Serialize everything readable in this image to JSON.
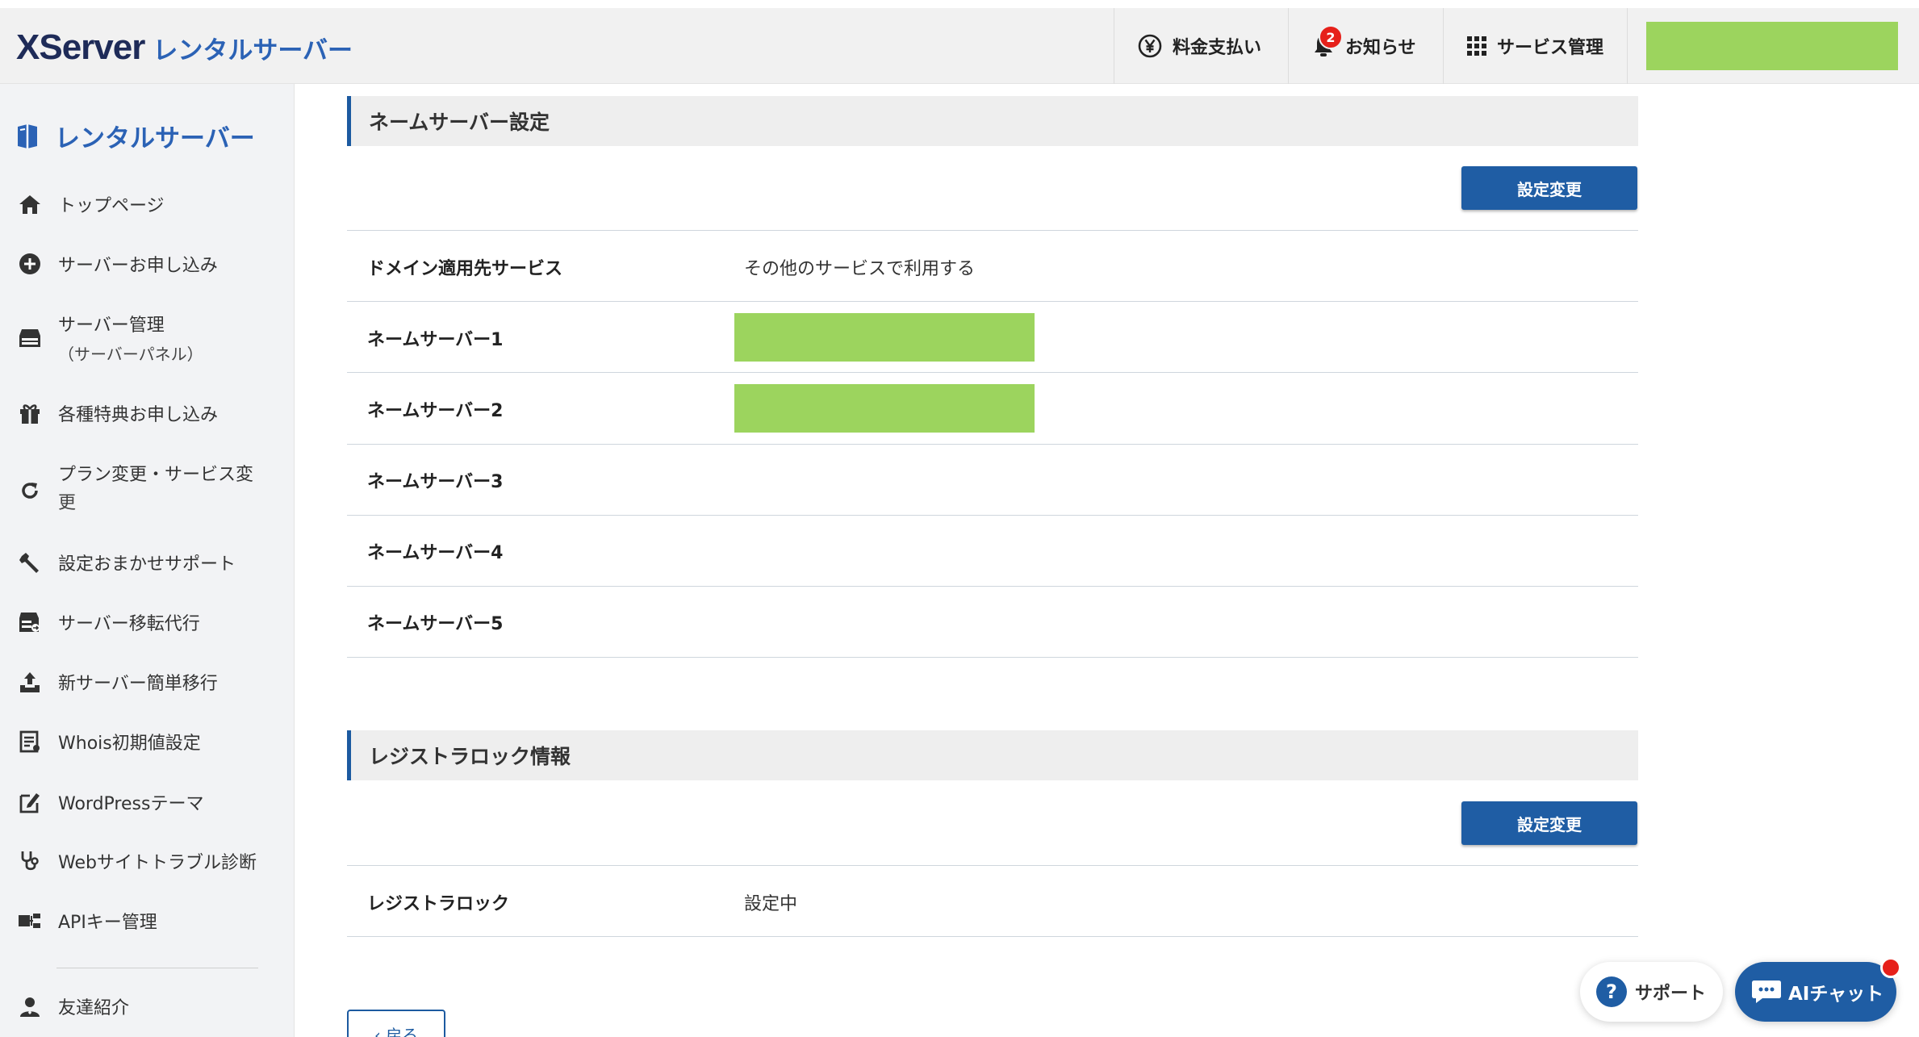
{
  "header": {
    "logo_main": "XServer",
    "logo_sub": "レンタルサーバー",
    "nav": {
      "payment": "料金支払い",
      "notice": "お知らせ",
      "notice_badge": "2",
      "service": "サービス管理"
    }
  },
  "sidebar": {
    "title": "レンタルサーバー",
    "items": [
      {
        "label": "トップページ",
        "icon": "home-icon"
      },
      {
        "label": "サーバーお申し込み",
        "icon": "plus-circle-icon"
      },
      {
        "label": "サーバー管理",
        "label2": "（サーバーパネル）",
        "icon": "server-icon"
      },
      {
        "label": "各種特典お申し込み",
        "icon": "gift-icon"
      },
      {
        "label": "プラン変更・サービス変",
        "label2": "更",
        "icon": "refresh-icon"
      },
      {
        "label": "設定おまかせサポート",
        "icon": "wrench-icon"
      },
      {
        "label": "サーバー移転代行",
        "icon": "server-transfer-icon"
      },
      {
        "label": "新サーバー簡単移行",
        "icon": "upload-icon"
      },
      {
        "label": "Whois初期値設定",
        "icon": "document-icon"
      },
      {
        "label": "WordPressテーマ",
        "icon": "edit-icon"
      },
      {
        "label": "Webサイトトラブル診断",
        "icon": "stethoscope-icon"
      },
      {
        "label": "APIキー管理",
        "icon": "api-key-icon"
      },
      {
        "label": "友達紹介",
        "icon": "person-icon"
      }
    ]
  },
  "nameserver": {
    "title": "ネームサーバー設定",
    "button": "設定変更",
    "rows": [
      {
        "label": "ドメイン適用先サービス",
        "value": "その他のサービスで利用する"
      },
      {
        "label": "ネームサーバー1",
        "value": ""
      },
      {
        "label": "ネームサーバー2",
        "value": ""
      },
      {
        "label": "ネームサーバー3",
        "value": ""
      },
      {
        "label": "ネームサーバー4",
        "value": ""
      },
      {
        "label": "ネームサーバー5",
        "value": ""
      }
    ]
  },
  "registry": {
    "title": "レジストラロック情報",
    "button": "設定変更",
    "rows": [
      {
        "label": "レジストラロック",
        "value": "設定中"
      }
    ]
  },
  "back_label": "‹ 戻る",
  "floating": {
    "support": "サポート",
    "ai_chat": "AIチャット"
  },
  "colors": {
    "primary": "#1f5da4",
    "redacted": "#9cd45e",
    "badge": "#e6201a"
  }
}
